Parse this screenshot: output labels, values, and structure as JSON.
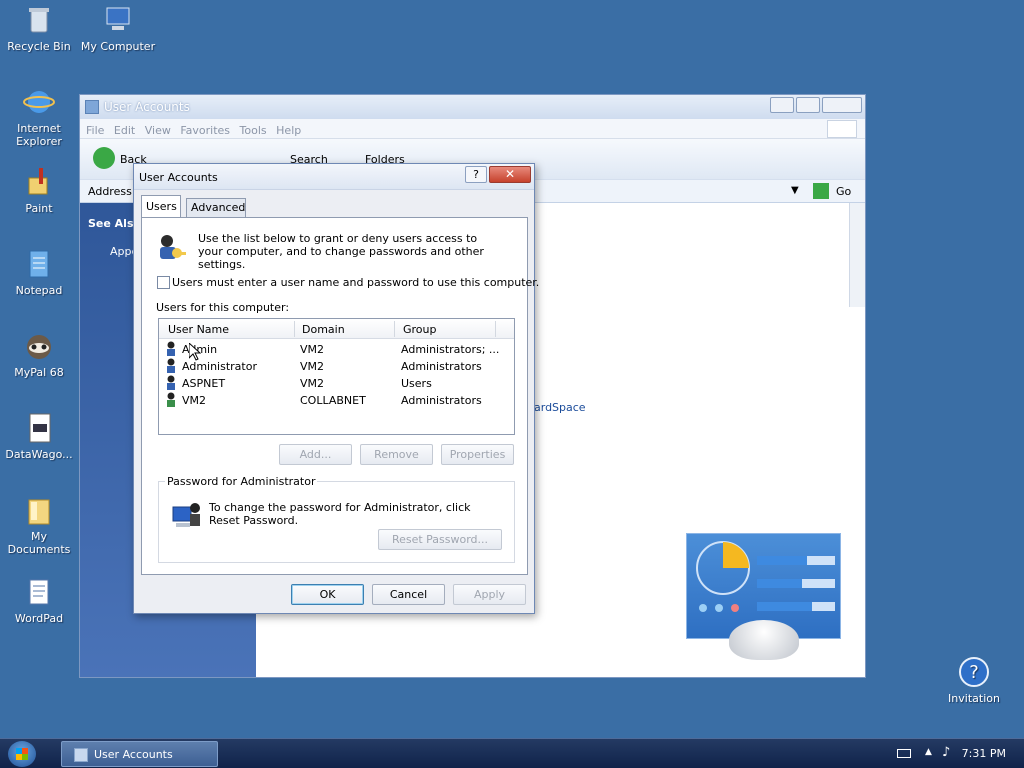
{
  "desktop": {
    "icons": [
      {
        "label": "Recycle Bin",
        "icon": "recycle-bin-icon"
      },
      {
        "label": "My Computer",
        "icon": "computer-icon"
      },
      {
        "label": "Internet Explorer",
        "icon": "ie-icon"
      },
      {
        "label": "Paint",
        "icon": "paint-icon"
      },
      {
        "label": "Notepad",
        "icon": "notepad-icon"
      },
      {
        "label": "MyPal 68",
        "icon": "mypal-icon"
      },
      {
        "label": "DataWago...",
        "icon": "datawagon-icon"
      },
      {
        "label": "My Documents",
        "icon": "folder-icon"
      },
      {
        "label": "WordPad",
        "icon": "wordpad-icon"
      },
      {
        "label": "Invitation",
        "icon": "help-icon"
      }
    ]
  },
  "bgwindow": {
    "title": "User Accounts",
    "menu": [
      "File",
      "Edit",
      "View",
      "Favorites",
      "Tools",
      "Help"
    ],
    "toolbar": {
      "back": "Back",
      "search": "Search",
      "folders": "Folders"
    },
    "address_label": "Address",
    "go_label": "Go",
    "see_also": "See Also",
    "side_link": "Appe",
    "content_link": "ardSpace"
  },
  "dialog": {
    "title": "User Accounts",
    "help": "?",
    "close": "✕",
    "tabs": [
      "Users",
      "Advanced"
    ],
    "intro": "Use the list below to grant or deny users access to your computer, and to change passwords and other settings.",
    "checkbox_label": "Users must enter a user name and password to use this computer.",
    "users_label": "Users for this computer:",
    "columns": [
      "User Name",
      "Domain",
      "Group"
    ],
    "users": [
      {
        "name": "Admin",
        "domain": "VM2",
        "group": "Administrators; ..."
      },
      {
        "name": "Administrator",
        "domain": "VM2",
        "group": "Administrators"
      },
      {
        "name": "ASPNET",
        "domain": "VM2",
        "group": "Users"
      },
      {
        "name": "VM2",
        "domain": "COLLABNET",
        "group": "Administrators"
      }
    ],
    "buttons": {
      "add": "Add...",
      "remove": "Remove",
      "properties": "Properties"
    },
    "password_group": "Password for Administrator",
    "password_text": "To change the password for Administrator, click Reset Password.",
    "reset": "Reset Password...",
    "ok": "OK",
    "cancel": "Cancel",
    "apply": "Apply"
  },
  "taskbar": {
    "item": "User Accounts",
    "time": "7:31 PM"
  },
  "colors": {
    "desktop": "#3a6ea5",
    "taskbar": "#1a2f58",
    "accent": "#3c7fb1"
  }
}
